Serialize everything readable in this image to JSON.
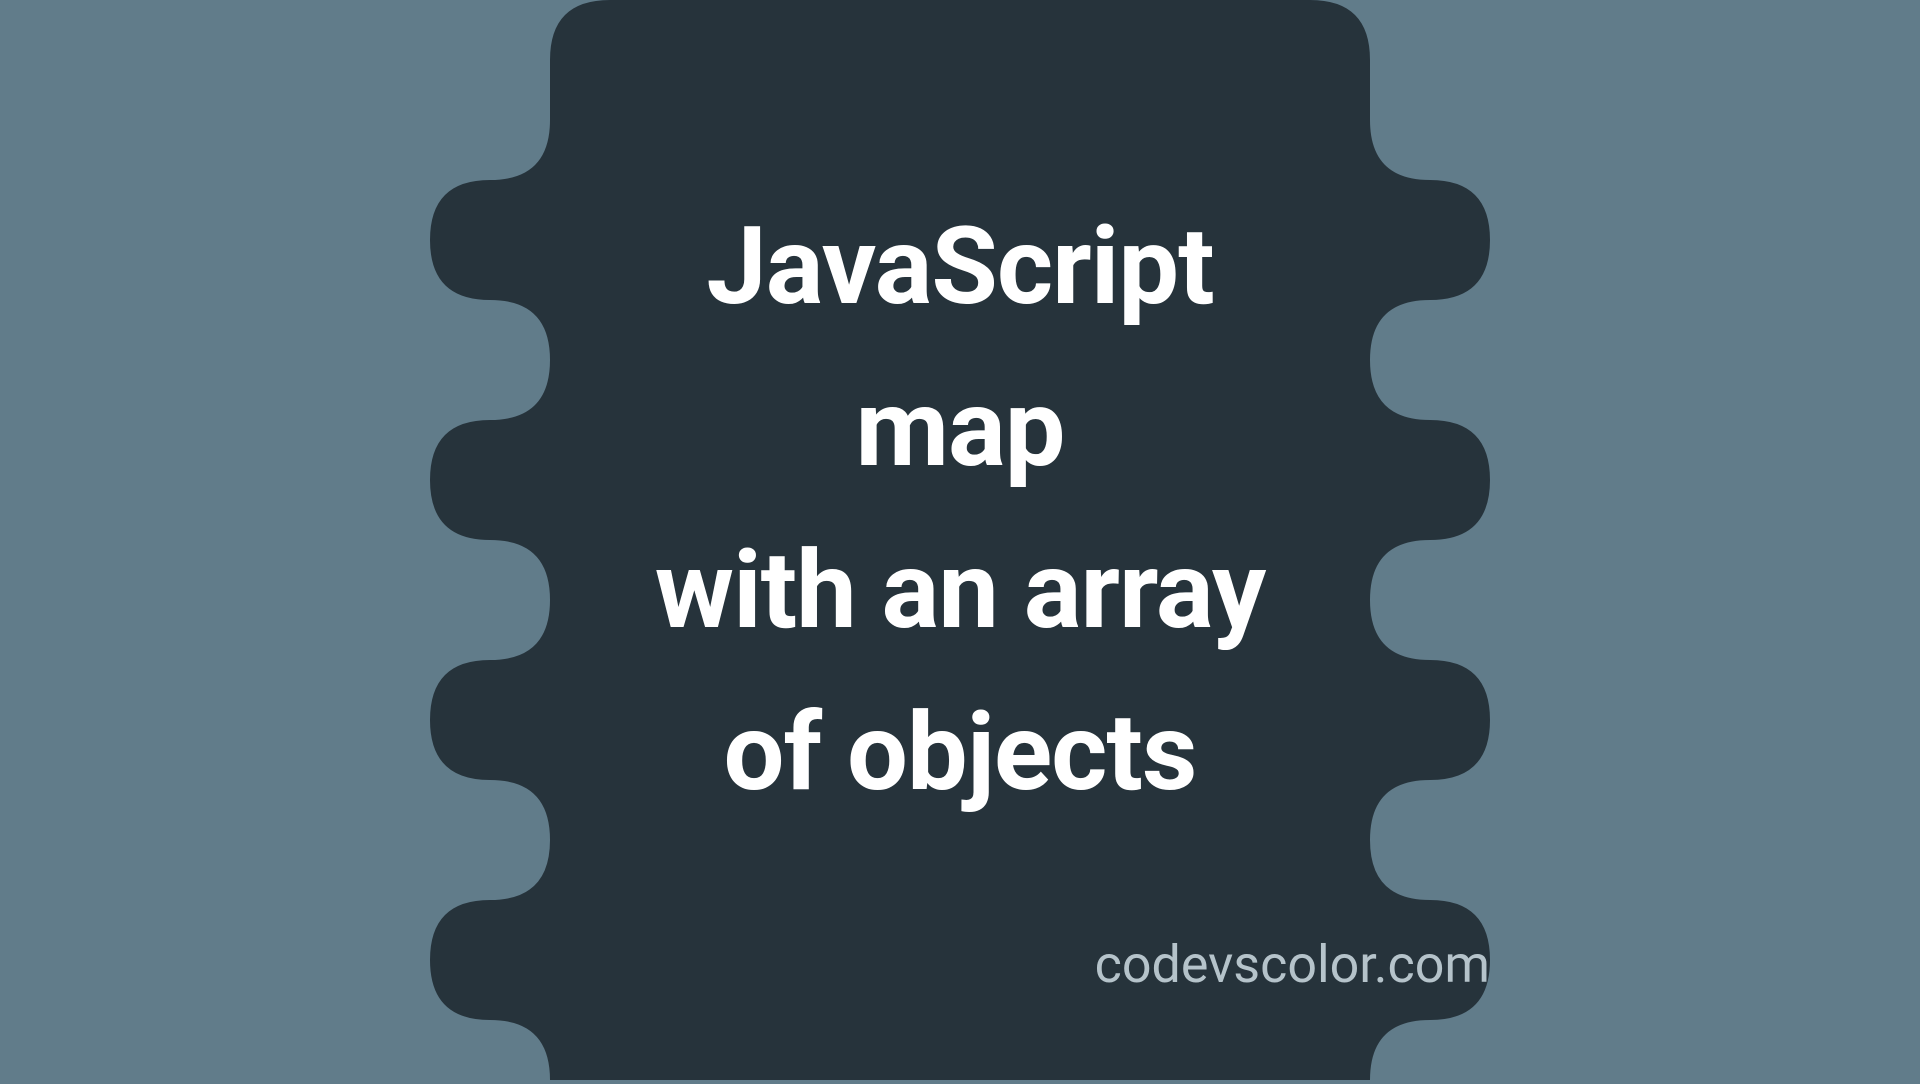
{
  "title": {
    "line1": "JavaScript",
    "line2": "map",
    "line3": "with an array",
    "line4": "of objects"
  },
  "footer": "codevscolor.com",
  "colors": {
    "background": "#617C8A",
    "blob": "#26333B",
    "text": "#FFFFFF",
    "footer_text": "#B5C3CA"
  }
}
